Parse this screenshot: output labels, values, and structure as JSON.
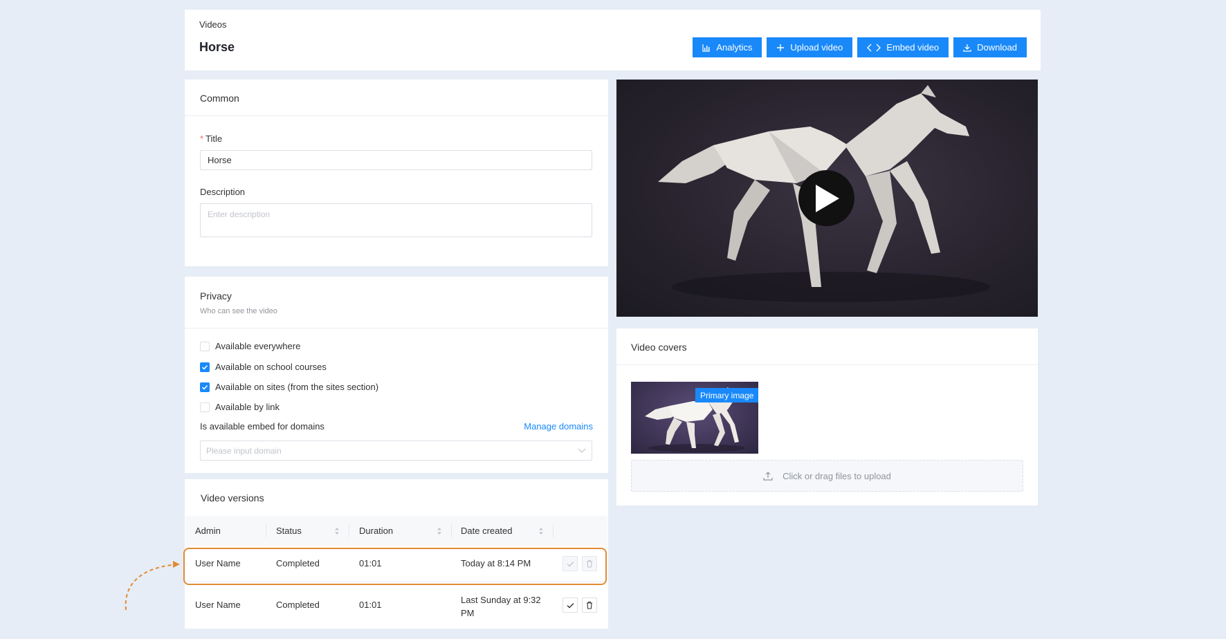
{
  "header": {
    "breadcrumb": "Videos",
    "title": "Horse",
    "buttons": {
      "analytics": "Analytics",
      "upload": "Upload video",
      "embed": "Embed video",
      "download": "Download"
    }
  },
  "common": {
    "heading": "Common",
    "title_label": "Title",
    "title_value": "Horse",
    "description_label": "Description",
    "description_placeholder": "Enter description"
  },
  "privacy": {
    "heading": "Privacy",
    "subheading": "Who can see the video",
    "options": [
      {
        "label": "Available everywhere",
        "checked": false
      },
      {
        "label": "Available on school courses",
        "checked": true
      },
      {
        "label": "Available on sites (from the sites section)",
        "checked": true
      },
      {
        "label": "Available by link",
        "checked": false
      }
    ],
    "embed_label": "Is available embed for domains",
    "manage_domains": "Manage domains",
    "domain_placeholder": "Please input domain"
  },
  "versions": {
    "heading": "Video versions",
    "columns": [
      "Admin",
      "Status",
      "Duration",
      "Date created"
    ],
    "rows": [
      {
        "admin": "User Name",
        "status": "Completed",
        "duration": "01:01",
        "date": "Today at 8:14 PM"
      },
      {
        "admin": "User Name",
        "status": "Completed",
        "duration": "01:01",
        "date": "Last Sunday at 9:32 PM"
      }
    ]
  },
  "covers": {
    "heading": "Video covers",
    "primary_badge": "Primary image",
    "upload_hint": "Click or drag files to upload"
  },
  "colors": {
    "accent": "#1989fa",
    "background": "#e6edf6",
    "highlight": "#e38a32"
  }
}
